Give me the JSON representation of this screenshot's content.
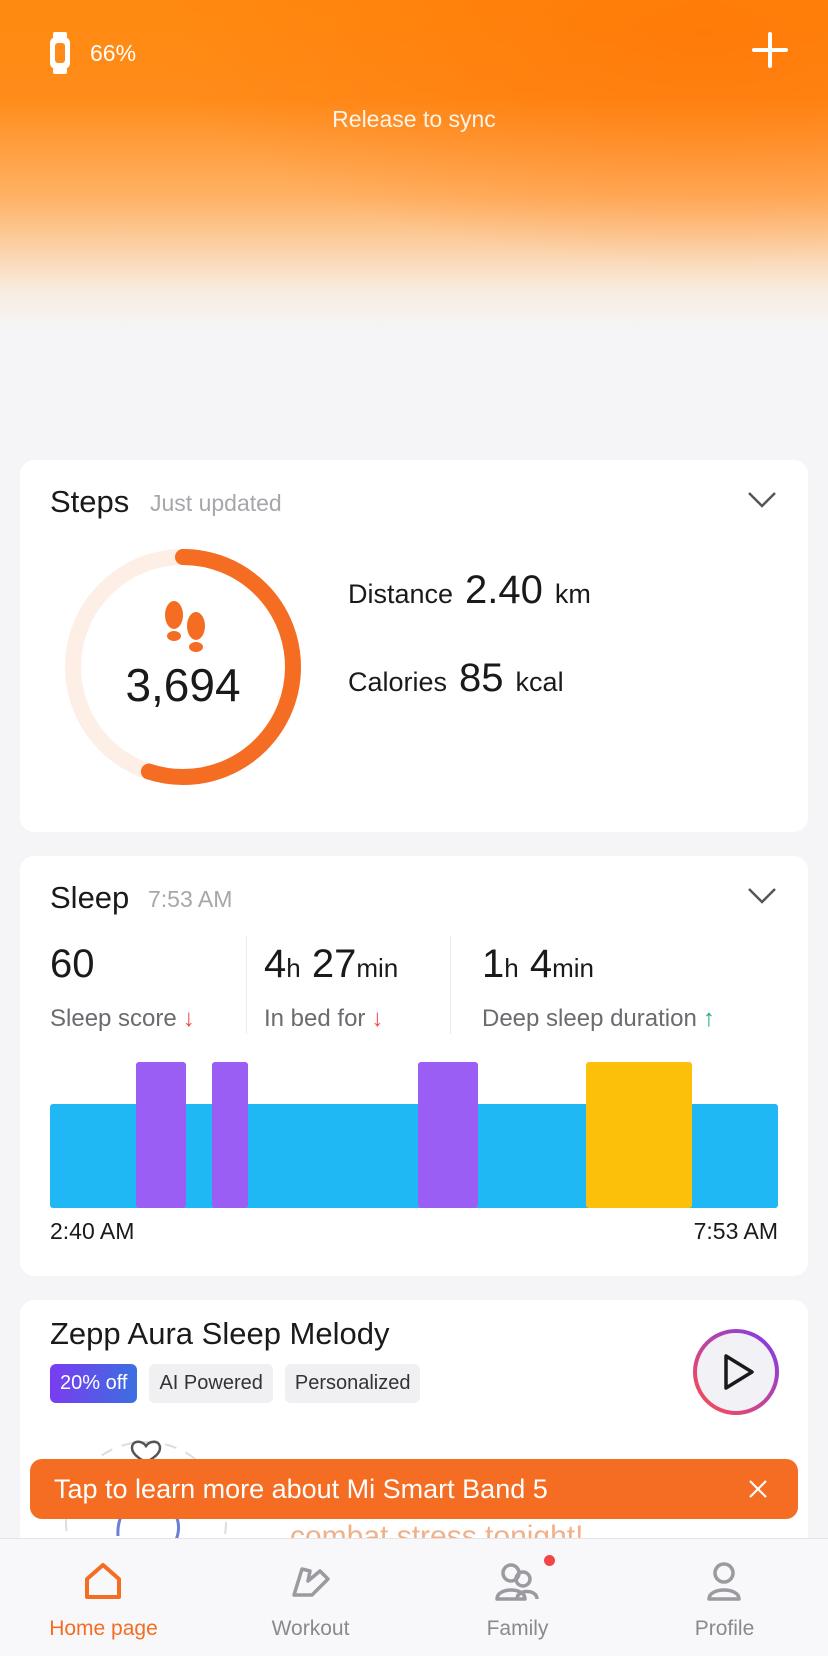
{
  "header": {
    "battery_percent": "66%",
    "sync_message": "Release to sync"
  },
  "steps": {
    "title": "Steps",
    "subtitle": "Just updated",
    "count": "3,694",
    "goal_progress": 0.55,
    "distance_label": "Distance",
    "distance_value": "2.40",
    "distance_unit": "km",
    "calories_label": "Calories",
    "calories_value": "85",
    "calories_unit": "kcal",
    "accent_color": "#f46d22"
  },
  "sleep": {
    "title": "Sleep",
    "subtitle": "7:53 AM",
    "score_value": "60",
    "score_label": "Sleep score",
    "inbed_hours": "4",
    "inbed_h_unit": "h",
    "inbed_minutes": "27",
    "inbed_min_unit": "min",
    "inbed_label": "In bed for",
    "deep_hours": "1",
    "deep_h_unit": "h",
    "deep_minutes": "4",
    "deep_min_unit": "min",
    "deep_label": "Deep sleep duration",
    "start_time": "2:40 AM",
    "end_time": "7:53 AM",
    "colors": {
      "light": "#1fb8f5",
      "rem": "#9b5ef5",
      "awake": "#fdc00a"
    }
  },
  "melody": {
    "title": "Zepp Aura Sleep Melody",
    "tags": [
      "20% off",
      "AI Powered",
      "Personalized"
    ],
    "description": "Recharge with AI Sleep Melodies and combat stress tonight!"
  },
  "toast": {
    "message": "Tap to learn more about Mi Smart Band 5"
  },
  "tabs": [
    {
      "label": "Home page",
      "active": true
    },
    {
      "label": "Workout",
      "active": false
    },
    {
      "label": "Family",
      "active": false
    },
    {
      "label": "Profile",
      "active": false
    }
  ]
}
